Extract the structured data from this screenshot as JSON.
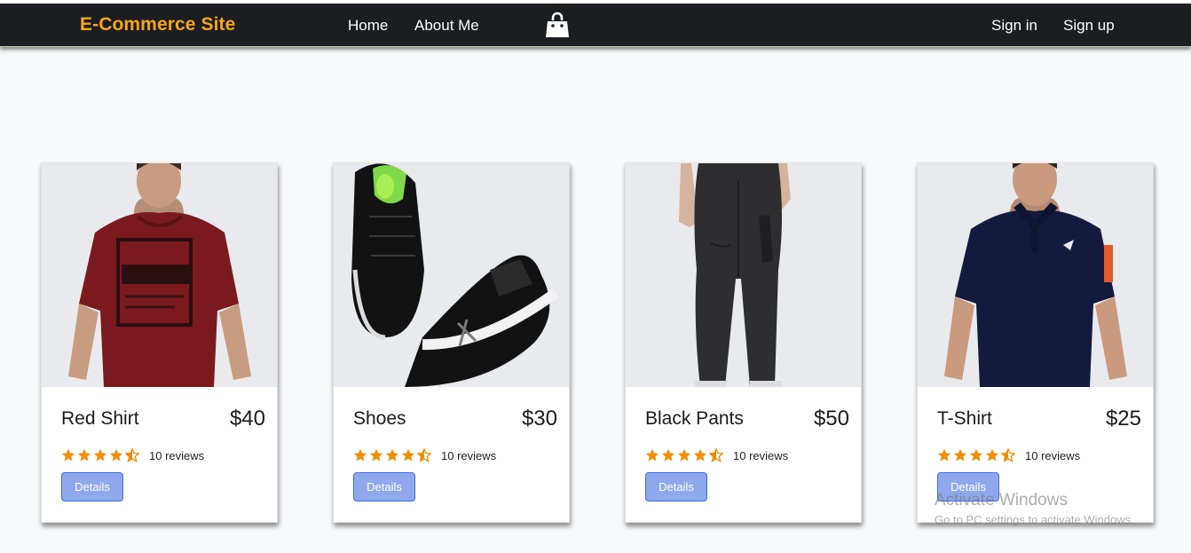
{
  "navbar": {
    "brand": "E-Commerce Site",
    "links": [
      {
        "label": "Home"
      },
      {
        "label": "About Me"
      }
    ],
    "cart_icon": "shopping-bag-icon",
    "auth": [
      {
        "label": "Sign in"
      },
      {
        "label": "Sign up"
      }
    ]
  },
  "products": [
    {
      "name": "Red Shirt",
      "price": "$40",
      "rating": 4.5,
      "reviews": "10 reviews",
      "button": "Details",
      "image": "red-shirt-photo"
    },
    {
      "name": "Shoes",
      "price": "$30",
      "rating": 4.5,
      "reviews": "10 reviews",
      "button": "Details",
      "image": "shoes-photo"
    },
    {
      "name": "Black Pants",
      "price": "$50",
      "rating": 4.5,
      "reviews": "10 reviews",
      "button": "Details",
      "image": "black-pants-photo"
    },
    {
      "name": "T-Shirt",
      "price": "$25",
      "rating": 4.5,
      "reviews": "10 reviews",
      "button": "Details",
      "image": "tshirt-photo"
    }
  ],
  "watermark": {
    "title": "Activate Windows",
    "subtitle": "Go to PC settings to activate Windows."
  },
  "colors": {
    "navbar_bg": "#1b1d21",
    "brand": "#f9a51a",
    "star": "#f38b00",
    "button_bg": "#8fa8ec",
    "button_border": "#3d6ce4",
    "page_bg": "#f8f9fa"
  }
}
